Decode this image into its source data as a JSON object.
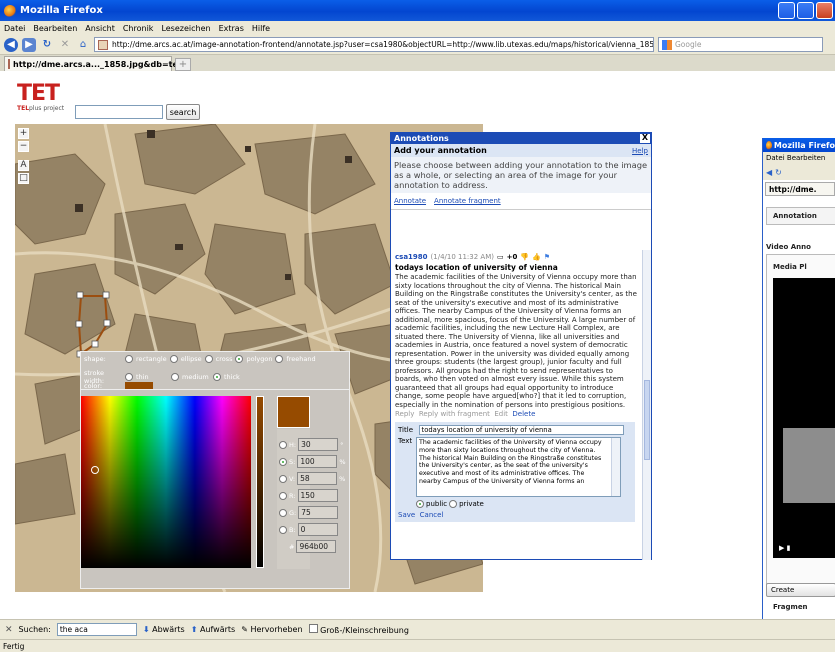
{
  "window": {
    "title": "Mozilla Firefox"
  },
  "menu": [
    "Datei",
    "Bearbeiten",
    "Ansicht",
    "Chronik",
    "Lesezeichen",
    "Extras",
    "Hilfe"
  ],
  "nav": {
    "url": "http://dme.arcs.ac.at/image-annotation-frontend/annotate.jsp?user=csa1980&objectURL=http://www.lib.utexas.edu/maps/historical/vienna_1858.jpg&db=tel",
    "search_placeholder": "Google"
  },
  "tab": {
    "label": "http://dme.arcs.a..._1858.jpg&db=tel",
    "new_tab": "+"
  },
  "logo": {
    "text": "TET",
    "sub_prefix": "TEL",
    "sub_suffix": "plus project"
  },
  "page_search": {
    "value": "",
    "button": "search"
  },
  "shape_panel": {
    "shape_label": "shape:",
    "shapes": [
      "rectangle",
      "ellipse",
      "cross",
      "polygon",
      "freehand"
    ],
    "selected_shape": "polygon",
    "stroke_label": "stroke width:",
    "strokes": [
      "thin",
      "medium",
      "thick"
    ],
    "selected_stroke": "thick",
    "color_label": "color:",
    "color": "#964b00"
  },
  "picker": {
    "fields": [
      {
        "label": "H:",
        "value": "30",
        "unit": "°",
        "selected": false
      },
      {
        "label": "S:",
        "value": "100",
        "unit": "%",
        "selected": true
      },
      {
        "label": "V:",
        "value": "58",
        "unit": "%",
        "selected": false
      },
      {
        "label": "R:",
        "value": "150",
        "unit": "",
        "selected": false
      },
      {
        "label": "G:",
        "value": "75",
        "unit": "",
        "selected": false
      },
      {
        "label": "B:",
        "value": "0",
        "unit": "",
        "selected": false
      }
    ],
    "hex_label": "#",
    "hex": "964b00"
  },
  "annotations": {
    "header": "Annotations",
    "close": "X",
    "add_title": "Add your annotation",
    "help": "Help",
    "intro": "Please choose between adding your annotation to the image as a whole, or selecting an area of the image for your annotation to address.",
    "link_annotate": "Annotate",
    "link_fragment": "Annotate fragment",
    "item": {
      "user": "csa1980",
      "date": "(1/4/10 11:32 AM)",
      "score": "+0",
      "title": "todays location of university of vienna",
      "body": "The academic facilities of the University of Vienna occupy more than sixty locations throughout the city of Vienna. The historical Main Building on the Ringstraße constitutes the University's center, as the seat of the university's executive and most of its administrative offices. The nearby Campus of the University of Vienna forms an additional, more spacious, focus of the University. A large number of academic facilities, including the new Lecture Hall Complex, are situated there. The University of Vienna, like all universities and academies in Austria, once featured a novel system of democratic representation. Power in the university was divided equally among three groups: students (the largest group), junior faculty and full professors. All groups had the right to send representatives to boards, who then voted on almost every issue. While this system guaranteed that all groups had equal opportunity to introduce change, some people have argued[who?] that it led to corruption, especially in the nomination of persons into prestigious positions.",
      "actions": {
        "reply": "Reply",
        "reply_fragment": "Reply with fragment",
        "edit": "Edit",
        "delete": "Delete"
      }
    },
    "edit": {
      "title_label": "Title",
      "title_value": "todays location of university of vienna",
      "text_label": "Text",
      "text_value": "The academic facilities of the University of Vienna occupy more than sixty locations throughout the city of Vienna. The historical Main Building on the Ringstraße constitutes the University's center, as the seat of the university's executive and most of its administrative offices. The nearby Campus of the University of Vienna forms an",
      "public": "public",
      "private": "private",
      "save": "Save",
      "cancel": "Cancel"
    }
  },
  "second_window": {
    "title": "Mozilla Firefo",
    "menu": "Datei  Bearbeiten",
    "tab": "http://dme.",
    "annotation_tab": "Annotation",
    "video_anno": "Video Anno",
    "media": "Media Pl",
    "create": "Create",
    "fragment": "Fragmen"
  },
  "findbar": {
    "close": "✕",
    "label": "Suchen:",
    "value": "the aca",
    "down": "Abwärts",
    "up": "Aufwärts",
    "highlight": "Hervorheben",
    "case": "Groß-/Kleinschreibung"
  },
  "status": "Fertig"
}
